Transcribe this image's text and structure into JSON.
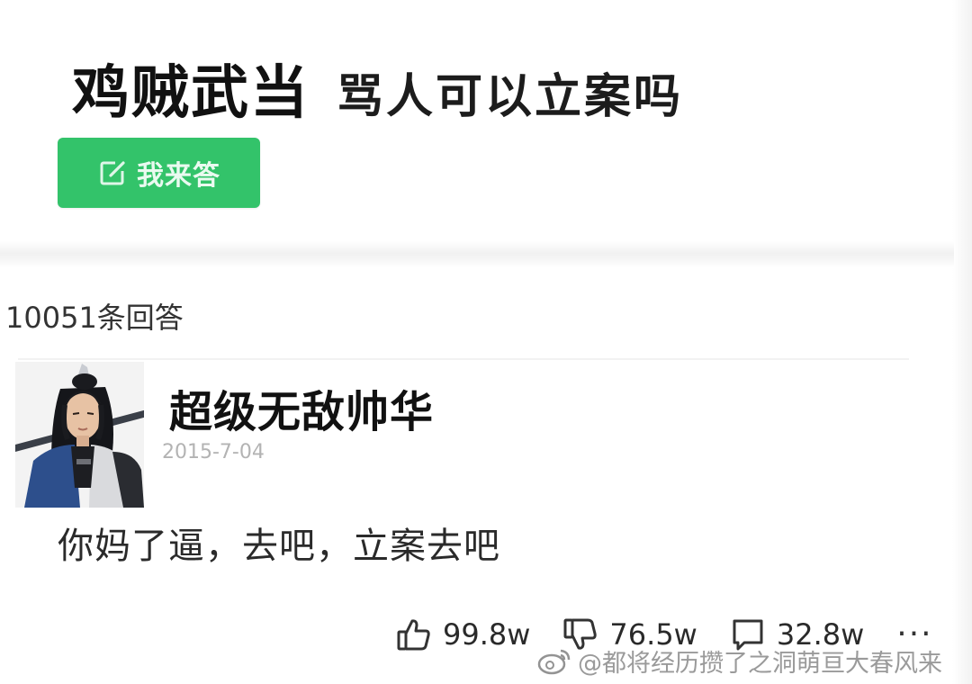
{
  "question": {
    "tag": "鸡贼武当",
    "title": "骂人可以立案吗"
  },
  "answer_button": {
    "label": "我来答",
    "icon": "edit-icon"
  },
  "answers_count": "10051条回答",
  "answer": {
    "author": "超级无敌帅华",
    "date": "2015-7-04",
    "content": "你妈了逼，去吧，立案去吧",
    "avatar": "swordsman-avatar"
  },
  "actions": {
    "like": {
      "icon": "thumbs-up-icon",
      "count": "99.8w"
    },
    "dislike": {
      "icon": "thumbs-down-icon",
      "count": "76.5w"
    },
    "comment": {
      "icon": "comment-icon",
      "count": "32.8w"
    },
    "more": {
      "icon": "more-icon",
      "label": "···"
    }
  },
  "watermark": {
    "icon": "weibo-icon",
    "text": "@都将经历攒了之洞萌亘大春风来"
  },
  "colors": {
    "accent_green": "#33c36a",
    "date_gray": "#b3b3b3"
  }
}
